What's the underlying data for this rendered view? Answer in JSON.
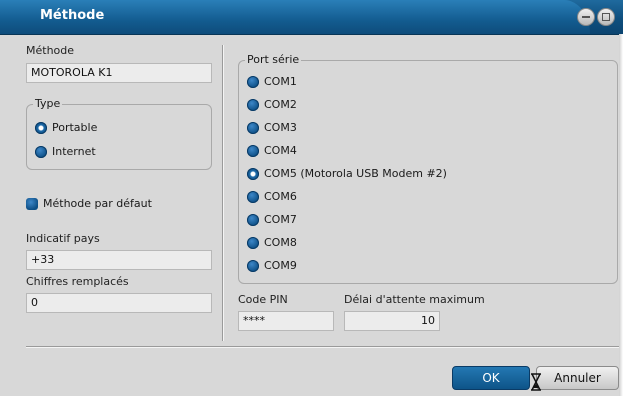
{
  "window": {
    "title": "Méthode"
  },
  "method": {
    "label": "Méthode",
    "value": "MOTOROLA K1"
  },
  "type": {
    "legend": "Type",
    "options": [
      {
        "label": "Portable",
        "selected": true
      },
      {
        "label": "Internet",
        "selected": false
      }
    ]
  },
  "default_method": {
    "label": "Méthode par défaut",
    "checked": true
  },
  "country_code": {
    "label": "Indicatif pays",
    "value": "+33"
  },
  "replaced_digits": {
    "label": "Chiffres remplacés",
    "value": "0"
  },
  "serial_port": {
    "legend": "Port série",
    "options": [
      {
        "label": "COM1",
        "selected": false
      },
      {
        "label": "COM2",
        "selected": false
      },
      {
        "label": "COM3",
        "selected": false
      },
      {
        "label": "COM4",
        "selected": false
      },
      {
        "label": "COM5 (Motorola USB Modem #2)",
        "selected": true
      },
      {
        "label": "COM6",
        "selected": false
      },
      {
        "label": "COM7",
        "selected": false
      },
      {
        "label": "COM8",
        "selected": false
      },
      {
        "label": "COM9",
        "selected": false
      }
    ]
  },
  "pin": {
    "label": "Code PIN",
    "value": "****"
  },
  "timeout": {
    "label": "Délai d'attente maximum",
    "value": "10"
  },
  "buttons": {
    "ok": "OK",
    "cancel": "Annuler"
  },
  "colors": {
    "accent": "#0e5488",
    "title_bar": "#135c90"
  }
}
